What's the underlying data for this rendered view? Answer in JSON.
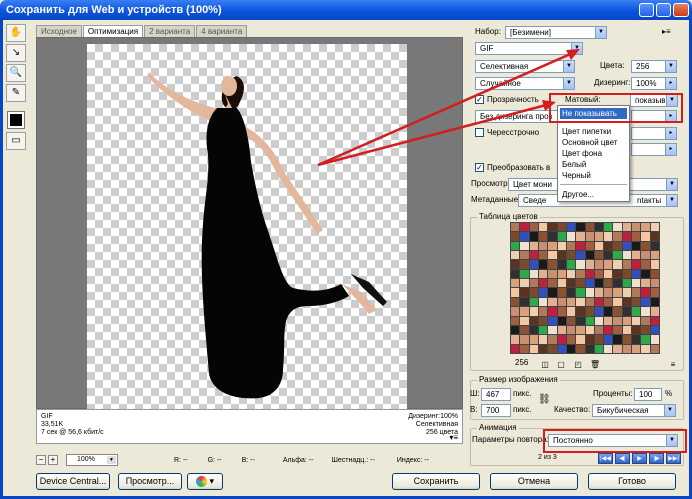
{
  "window": {
    "title": "Сохранить для Web и устройств (100%)"
  },
  "tools": [
    "hand-icon",
    "slice-select-icon",
    "zoom-icon",
    "eyedropper-icon",
    "color-swatch",
    "toggle-slices-icon"
  ],
  "tabs": [
    "Исходное",
    "Оптимизация",
    "2 варианта",
    "4 варианта"
  ],
  "image_info": {
    "left": [
      "GIF",
      "33,51K",
      "7 сек @ 56,6 кбит/с"
    ],
    "right": [
      "Дизеринг:100%",
      "Селективная",
      "256 цвета"
    ]
  },
  "statusbar": {
    "zoom": "100%",
    "r": "R: --",
    "g": "G: --",
    "b": "B: --",
    "alpha": "Альфа: --",
    "hex": "Шестнадц.: --",
    "index": "Индекс: --"
  },
  "preset": {
    "label": "Набор:",
    "value": "[Безимени]"
  },
  "format": {
    "value": "GIF"
  },
  "reduction": {
    "value": "Селективная"
  },
  "colors": {
    "label": "Цвета:",
    "value": "256"
  },
  "dither_algo": {
    "value": "Случайное"
  },
  "dither": {
    "label": "Дизеринг:",
    "value": "100%"
  },
  "transparency": {
    "label": "Прозрачность",
    "checked": "✓"
  },
  "matte": {
    "label": "Матовый:",
    "value": "показыв"
  },
  "transparency_dither": {
    "value": "Без дизеринга проз"
  },
  "interlaced": {
    "label": "Чересстрочно"
  },
  "convert_srgb": {
    "label": "Преобразовать в ",
    "checked": "✓"
  },
  "preview": {
    "label": "Просмотр:",
    "value": "Цвет мони"
  },
  "metadata": {
    "label": "Метаданные:",
    "value": "Сведе",
    "tail": "ntакты"
  },
  "color_table": {
    "title": "Таблица цветов",
    "count": "256",
    "colors": [
      "#b07a5a",
      "#1a1a1a",
      "#d9a07c",
      "#7b4a2d",
      "#e0b090",
      "#f4c7a4",
      "#2fa84a",
      "#c02040",
      "#8a5230",
      "#eecfb0",
      "#3050c0",
      "#c89070",
      "#5a3420",
      "#f0e0d0",
      "#a06040",
      "#303030"
    ]
  },
  "image_size": {
    "title": "Размер изображения",
    "w_label": "Ш:",
    "w": "467",
    "h_label": "В:",
    "h": "700",
    "unit": "пикс.",
    "percent_label": "Проценты:",
    "percent": "100",
    "pct": "%",
    "quality_label": "Качество:",
    "quality": "Бикубическая"
  },
  "animation": {
    "title": "Анимация",
    "loop_label": "Параметры повтора:",
    "loop": "Постоянно",
    "frame": "2 из 3",
    "controls": [
      "first",
      "prev",
      "play",
      "next",
      "last"
    ]
  },
  "matte_menu": {
    "items": [
      "Не показывать",
      "Цвет пипетки",
      "Основной цвет",
      "Цвет фона",
      "Белый",
      "Черный",
      "Другое..."
    ],
    "selected": "Не показывать"
  },
  "buttons": {
    "device_central": "Device Central...",
    "preview": "Просмотр...",
    "save": "Сохранить",
    "cancel": "Отмена",
    "done": "Готово"
  }
}
